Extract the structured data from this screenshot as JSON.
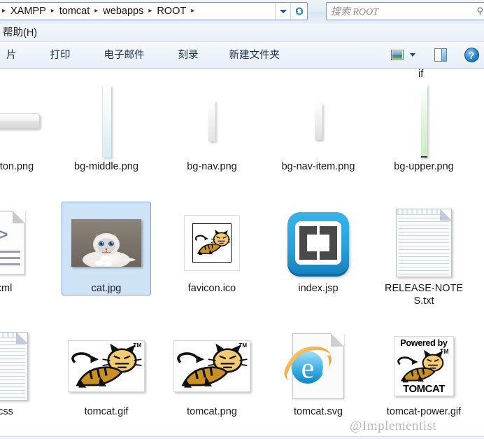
{
  "window": {
    "address": {
      "crumbs": [
        "XAMPP",
        "tomcat",
        "webapps",
        "ROOT"
      ],
      "separator": "▸",
      "dropdown_icon": "chevron-down-icon",
      "refresh_icon": "refresh-icon"
    },
    "search": {
      "placeholder": "搜索 ROOT",
      "icon": "search-icon"
    }
  },
  "menubar": {
    "items": [
      "帮助(H)"
    ]
  },
  "toolbar": {
    "buttons": [
      "片",
      "打印",
      "电子邮件",
      "刻录",
      "新建文件夹"
    ],
    "view_icon": "view-layout-icon",
    "view_arrow_icon": "chevron-down-icon",
    "preview_pane_icon": "preview-pane-icon",
    "help_icon": "help-icon",
    "help_glyph": "?"
  },
  "content": {
    "clipped_label_top": "if",
    "items": [
      {
        "name": "...ton.png",
        "label": "ton.png",
        "icon": "image-button-strip",
        "clipped": true,
        "selected": false
      },
      {
        "name": "bg-middle.png",
        "label": "bg-middle.png",
        "icon": "image-strip-middle",
        "clipped": false,
        "selected": false
      },
      {
        "name": "bg-nav.png",
        "label": "bg-nav.png",
        "icon": "image-strip-nav",
        "clipped": false,
        "selected": false
      },
      {
        "name": "bg-nav-item.png",
        "label": "bg-nav-item.png",
        "icon": "image-strip-navitem",
        "clipped": false,
        "selected": false
      },
      {
        "name": "bg-upper.png",
        "label": "bg-upper.png",
        "icon": "image-strip-upper",
        "clipped": false,
        "selected": false
      },
      {
        "name": "...d.xml",
        "label": "d.xml",
        "icon": "xml-file-icon",
        "clipped": true,
        "selected": false
      },
      {
        "name": "cat.jpg",
        "label": "cat.jpg",
        "icon": "photo-thumbnail",
        "clipped": false,
        "selected": true
      },
      {
        "name": "favicon.ico",
        "label": "favicon.ico",
        "icon": "tomcat-favicon",
        "clipped": false,
        "selected": false
      },
      {
        "name": "index.jsp",
        "label": "index.jsp",
        "icon": "brackets-app-icon",
        "clipped": false,
        "selected": false
      },
      {
        "name": "RELEASE-NOTES.txt",
        "label": "RELEASE-NOTES.txt",
        "icon": "text-file-icon",
        "clipped": false,
        "selected": false
      },
      {
        "name": "...at.css",
        "label": "at.css",
        "icon": "text-file-icon",
        "clipped": true,
        "selected": false
      },
      {
        "name": "tomcat.gif",
        "label": "tomcat.gif",
        "icon": "tomcat-logo",
        "clipped": false,
        "selected": false
      },
      {
        "name": "tomcat.png",
        "label": "tomcat.png",
        "icon": "tomcat-logo",
        "clipped": false,
        "selected": false
      },
      {
        "name": "tomcat.svg",
        "label": "tomcat.svg",
        "icon": "ie-browser-file",
        "clipped": false,
        "selected": false
      },
      {
        "name": "tomcat-power.gif",
        "label": "tomcat-power.gif",
        "icon": "tomcat-powered-logo",
        "clipped": false,
        "selected": false
      }
    ],
    "tomcat_logo": {
      "tm": "TM",
      "powered_top": "Powered by",
      "powered_bottom": "TOMCAT"
    }
  },
  "watermark": {
    "text": "@Implementist"
  },
  "colors": {
    "selection_fill": "#cfe3f7",
    "selection_border": "#7da2ce",
    "chrome_blue": "#dbe6f4",
    "accent": "#2f86cc",
    "tomcat_gold": "#d9a227"
  }
}
